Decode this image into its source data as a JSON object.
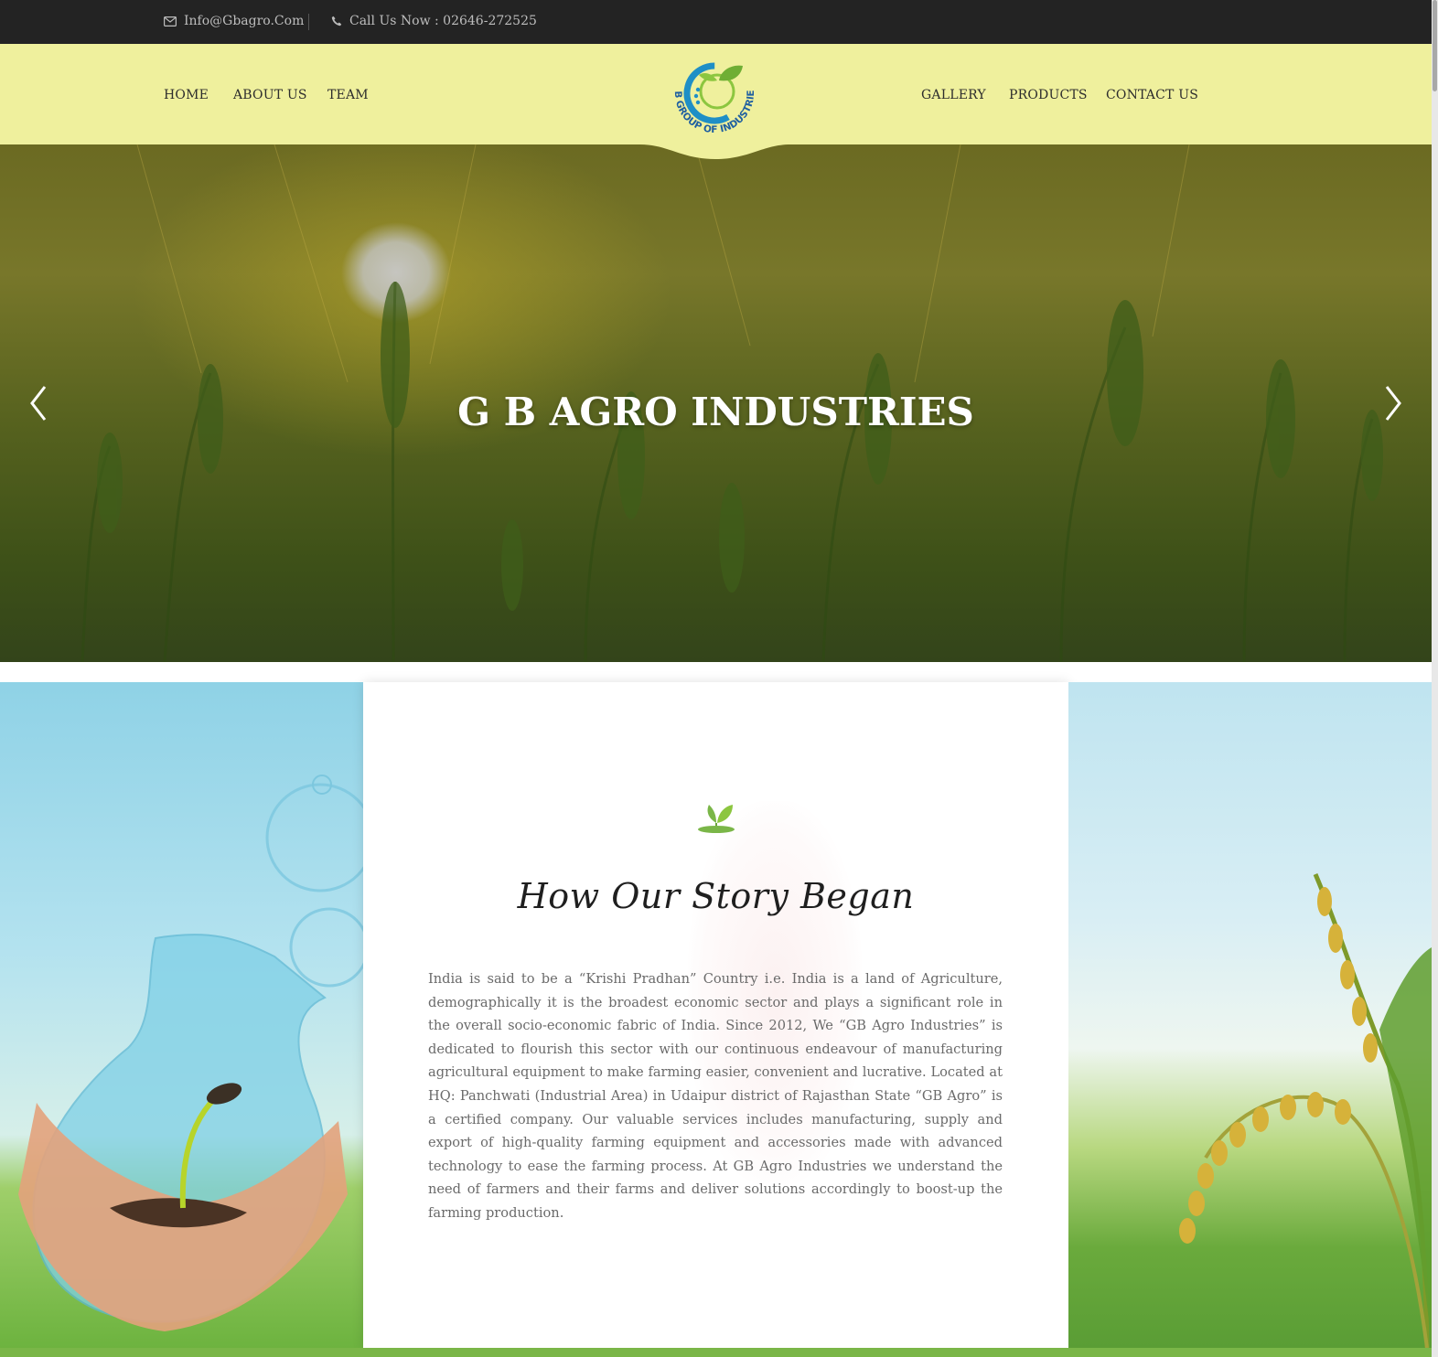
{
  "topbar": {
    "email": "Info@Gbagro.Com",
    "phone": "Call Us Now : 02646-272525"
  },
  "nav": {
    "left": [
      "HOME",
      "ABOUT US",
      "TEAM"
    ],
    "right": [
      "GALLERY",
      "PRODUCTS",
      "CONTACT US"
    ],
    "logo_text": "GB GROUP OF INDUSTRIES"
  },
  "hero": {
    "title": "G B AGRO INDUSTRIES"
  },
  "story": {
    "heading": "How Our Story Began",
    "body": "India is said to be a “Krishi Pradhan” Country i.e. India is a land of Agriculture, demographically it is the broadest economic sector and plays a significant role in the overall socio-economic fabric of India. Since 2012, We “GB Agro Industries” is dedicated to flourish this sector with our continuous endeavour of manufacturing agricultural equipment to make farming easier, convenient and lucrative. Located at HQ: Panchwati (Industrial Area) in Udaipur district of Rajasthan State “GB Agro” is a certified company. Our valuable services includes manufacturing, supply and export of high-quality farming equipment and accessories made with advanced technology to ease the farming process. At GB Agro Industries we understand the need of farmers and their farms and deliver solutions accordingly to boost-up the farming production."
  },
  "colors": {
    "topbar": "#232323",
    "nav": "#eff09d",
    "accent_green": "#7ab648",
    "logo_blue": "#1f8fc6"
  },
  "icons": [
    "envelope-icon",
    "phone-icon",
    "chevron-left-icon",
    "chevron-right-icon",
    "sprout-icon"
  ]
}
